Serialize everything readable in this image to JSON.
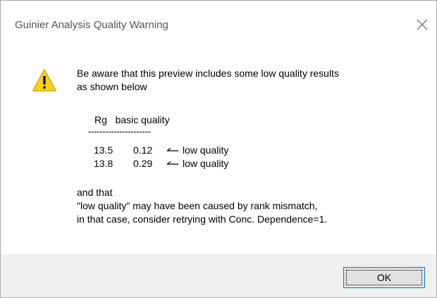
{
  "dialog": {
    "title": "Guinier Analysis Quality Warning",
    "close_symbol": "close-icon",
    "icon": "warning-icon",
    "icon_colors": {
      "fill": "#fcd116",
      "outline": "#c9a100",
      "glyph": "#000000"
    }
  },
  "message": {
    "line1": "Be aware that this preview includes some low quality results",
    "line2": "as shown below",
    "table_header": "Rg   basic quality",
    "separator": "----------------------",
    "rows": [
      {
        "rg": "13.5",
        "quality": "0.12",
        "note": "low quality"
      },
      {
        "rg": "13.8",
        "quality": "0.29",
        "note": "low quality"
      }
    ],
    "line3": "and that",
    "line4": "\"low quality\" may have been caused by rank mismatch,",
    "line5": "in that case, consider retrying with Conc. Dependence=1."
  },
  "footer": {
    "ok_label": "OK"
  }
}
